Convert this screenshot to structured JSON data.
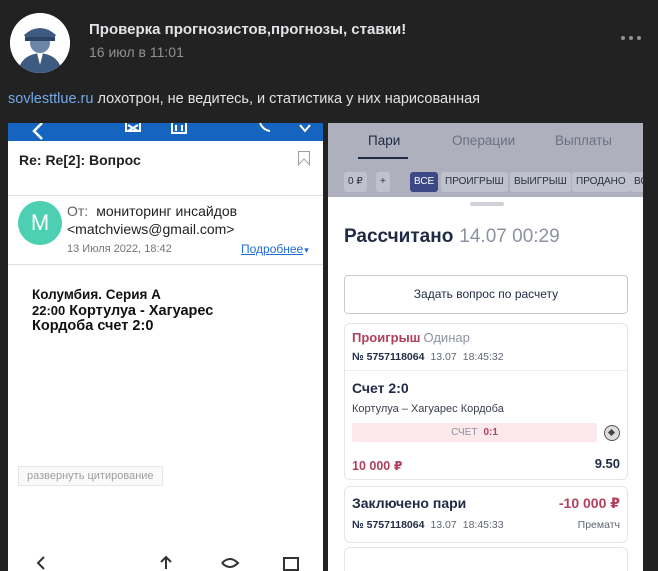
{
  "post": {
    "author": "Проверка прогнозистов,прогнозы, ставки!",
    "date": "16 июл в 11:01",
    "link_text": "sovlesttlue.ru",
    "text": " лохотрон, не ведитесь, и статистика у них нарисованная"
  },
  "mail": {
    "subject": "Re: Re[2]: Вопрос",
    "avatar_letter": "M",
    "from_label": "От:",
    "from_name": "мониторинг инсайдов",
    "from_email": "<matchviews@gmail.com>",
    "date": "13 Июля 2022, 18:42",
    "details_link": "Подробнее",
    "body_line1": "Колумбия. Серия А",
    "body_time": "22:00",
    "body_line2": " Кортулуа - Хагуарес",
    "body_line3": "Кордоба счет 2:0",
    "expand_quote": "развернуть цитирование",
    "accent_color": "#1565c0"
  },
  "app": {
    "tabs": [
      "Пари",
      "Операции",
      "Выплаты"
    ],
    "chips": [
      "0 ₽",
      "+",
      "ВСЕ",
      "ПРОИГРЫШ",
      "ВЫИГРЫШ",
      "ПРОДАНО",
      "ВО"
    ],
    "sheet_title": "Рассчитано",
    "sheet_datetime": "14.07 00:29",
    "ask_button": "Задать вопрос по расчету",
    "bet": {
      "status": "Проигрыш",
      "type": "Одинар",
      "id": "№ 5757118064",
      "date": "13.07",
      "time": "18:45:32",
      "market": "Счет 2:0",
      "teams": "Кортулуа – Хагуарес Кордоба",
      "score_label": "СЧЕТ",
      "score_value": "0:1",
      "stake": "10 000 ₽",
      "odds": "9.50"
    },
    "deal": {
      "title": "Заключено пари",
      "amount": "-10 000 ₽",
      "id": "№ 5757118064",
      "date": "13.07",
      "time": "18:45:33",
      "type": "Прематч"
    },
    "loss_color": "#b0405e",
    "active_chip_color": "#3b4a86"
  }
}
